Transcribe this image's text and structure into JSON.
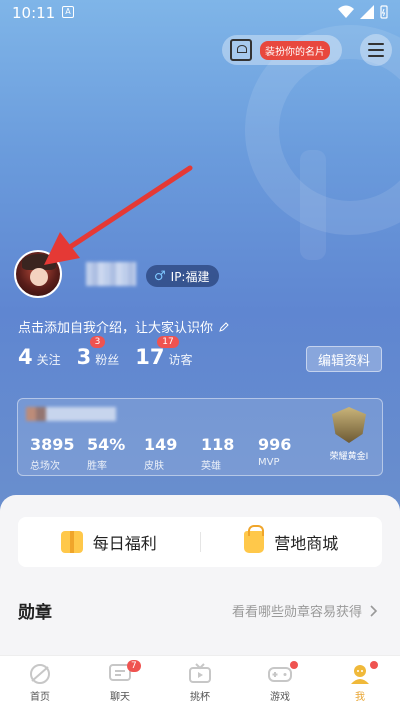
{
  "statusbar": {
    "time": "10:11",
    "notif_letter": "A"
  },
  "header": {
    "card_button_label": "装扮你的名片"
  },
  "profile": {
    "ip_label": "IP:福建",
    "intro": "点击添加自我介绍，让大家认识你",
    "stats": [
      {
        "value": "4",
        "label": "关注",
        "badge": ""
      },
      {
        "value": "3",
        "label": "粉丝",
        "badge": "3"
      },
      {
        "value": "17",
        "label": "访客",
        "badge": "17"
      }
    ],
    "edit_label": "编辑资料"
  },
  "game_card": {
    "stats": [
      {
        "value": "3895",
        "label": "总场次"
      },
      {
        "value": "54%",
        "label": "胜率"
      },
      {
        "value": "149",
        "label": "皮肤"
      },
      {
        "value": "118",
        "label": "英雄"
      },
      {
        "value": "996",
        "label": "MVP"
      }
    ],
    "rank_label": "荣耀黄金I"
  },
  "benefits": {
    "daily": "每日福利",
    "shop": "营地商城"
  },
  "medals": {
    "title": "勋章",
    "link": "看看哪些勋章容易获得"
  },
  "tabbar": [
    {
      "label": "首页",
      "badge": "",
      "dot": false
    },
    {
      "label": "聊天",
      "badge": "7",
      "dot": false
    },
    {
      "label": "挑杯",
      "badge": "",
      "dot": false
    },
    {
      "label": "游戏",
      "badge": "",
      "dot": true
    },
    {
      "label": "我",
      "badge": "",
      "dot": true
    }
  ],
  "colors": {
    "accent": "#e8a533",
    "badge_red": "#ef5350",
    "arrow_red": "#e53935"
  }
}
